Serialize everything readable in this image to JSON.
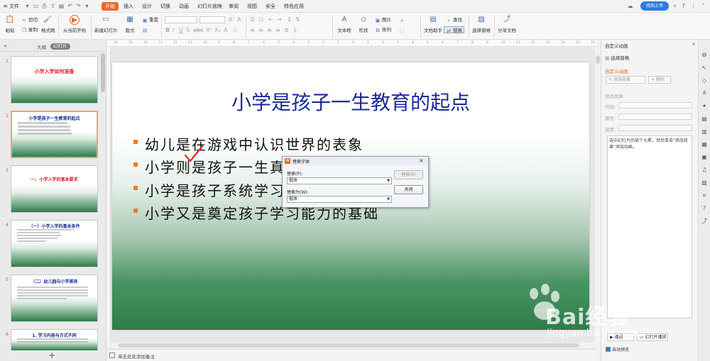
{
  "menubar": {
    "file": "文件",
    "tabs": [
      "开始",
      "插入",
      "设计",
      "切换",
      "动画",
      "幻灯片放映",
      "审阅",
      "视图",
      "安全",
      "特色应用"
    ],
    "active_tab": "开始",
    "upload_label": "找到上传"
  },
  "ribbon": {
    "paste": "粘贴",
    "cut": "剪切",
    "copy": "复制",
    "format_painter": "格式刷",
    "from_current": "从当前开始",
    "new_slide": "新建幻灯片",
    "layout": "版式",
    "reset": "重置",
    "text_box": "文本框",
    "shape": "形状",
    "picture": "图片",
    "arrange": "排列",
    "find": "查找",
    "replace": "替换",
    "doc_assistant": "文档助手",
    "select_pane": "选择窗格",
    "share_doc": "分享文档"
  },
  "leftpane": {
    "tab_outline": "大纲",
    "tab_slides": "幻灯片",
    "thumbs": [
      {
        "num": "1",
        "title": "小学入学如何准备",
        "color": "#e0202a"
      },
      {
        "num": "2",
        "title": "小学是孩子一生教育的起点",
        "color": "#1a2a9a"
      },
      {
        "num": "3",
        "title": "一、小学入学的基本要求",
        "color": "#e0202a"
      },
      {
        "num": "4",
        "title": "（一）小学入学的基本条件",
        "color": "#1a2a9a"
      },
      {
        "num": "5",
        "title": "（二）幼儿园与小学差异",
        "color": "#1a2a9a"
      },
      {
        "num": "6",
        "title": "1. 学习内容与方式不同",
        "color": "#1a2a9a"
      }
    ],
    "add_slide": "+"
  },
  "ruler": {
    "ticks": [
      "16",
      "15",
      "14",
      "13",
      "12",
      "11",
      "10",
      "9",
      "8",
      "7",
      "6",
      "5",
      "4",
      "3",
      "2",
      "1",
      "0",
      "1",
      "2",
      "3",
      "4",
      "5",
      "6",
      "7",
      "8",
      "9",
      "10",
      "11",
      "12",
      "13",
      "14",
      "15",
      "16"
    ]
  },
  "slide": {
    "title": "小学是孩子一生教育的起点",
    "bullets": [
      "幼儿是在游戏中认识世界的表象",
      "小学则是孩子一生真正教育的起点",
      "小学是孩子系统学习知识的开始",
      "小学又是奠定孩子学习能力的基础"
    ],
    "bullet_color": "#f07a22"
  },
  "notes": {
    "placeholder": "单击此处添加备注"
  },
  "dialog": {
    "title": "替换字体",
    "replace_label": "替换(P):",
    "replace_value": "楷体",
    "with_label": "替换为(W):",
    "with_value": "楷体",
    "replace_button": "替换(R)",
    "close_button": "关闭"
  },
  "rightpane": {
    "title": "自定义动画",
    "select_pane": "选择窗格",
    "section": "自定义动画",
    "add_effect": "添加效果",
    "delete": "删除",
    "modify_effect": "修改效果",
    "start_label": "开始:",
    "property_label": "属性:",
    "speed_label": "速度:",
    "hint": "选中幻灯片的某个元素，然后单击\"添加效果\"添加动画。",
    "play": "播放",
    "slideshow": "幻灯片播放",
    "autopreview": "自动预览"
  },
  "watermark": {
    "main": "Bai经验",
    "sub": "jingyan.baidu.com"
  }
}
